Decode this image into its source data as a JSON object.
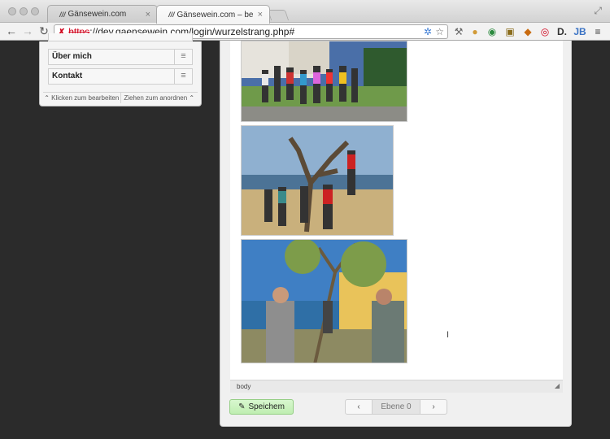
{
  "browser": {
    "tabs": [
      {
        "label": "Gänsewein.com"
      },
      {
        "label": "Gänsewein.com – bearbeit"
      }
    ],
    "url": {
      "scheme": "https",
      "rest": "://dev.gaensewein.com/login/wurzelstrang.php#"
    }
  },
  "menu_panel": {
    "items": [
      {
        "label": "Über mich"
      },
      {
        "label": "Kontakt"
      }
    ],
    "footer": {
      "edit_hint": "Klicken zum bearbeiten",
      "reorder_hint": "Ziehen zum anordnen"
    }
  },
  "editor": {
    "status_path": "body",
    "save_label": "Speichem",
    "level_label": "Ebene 0",
    "prev_label": "‹",
    "next_label": "›"
  }
}
